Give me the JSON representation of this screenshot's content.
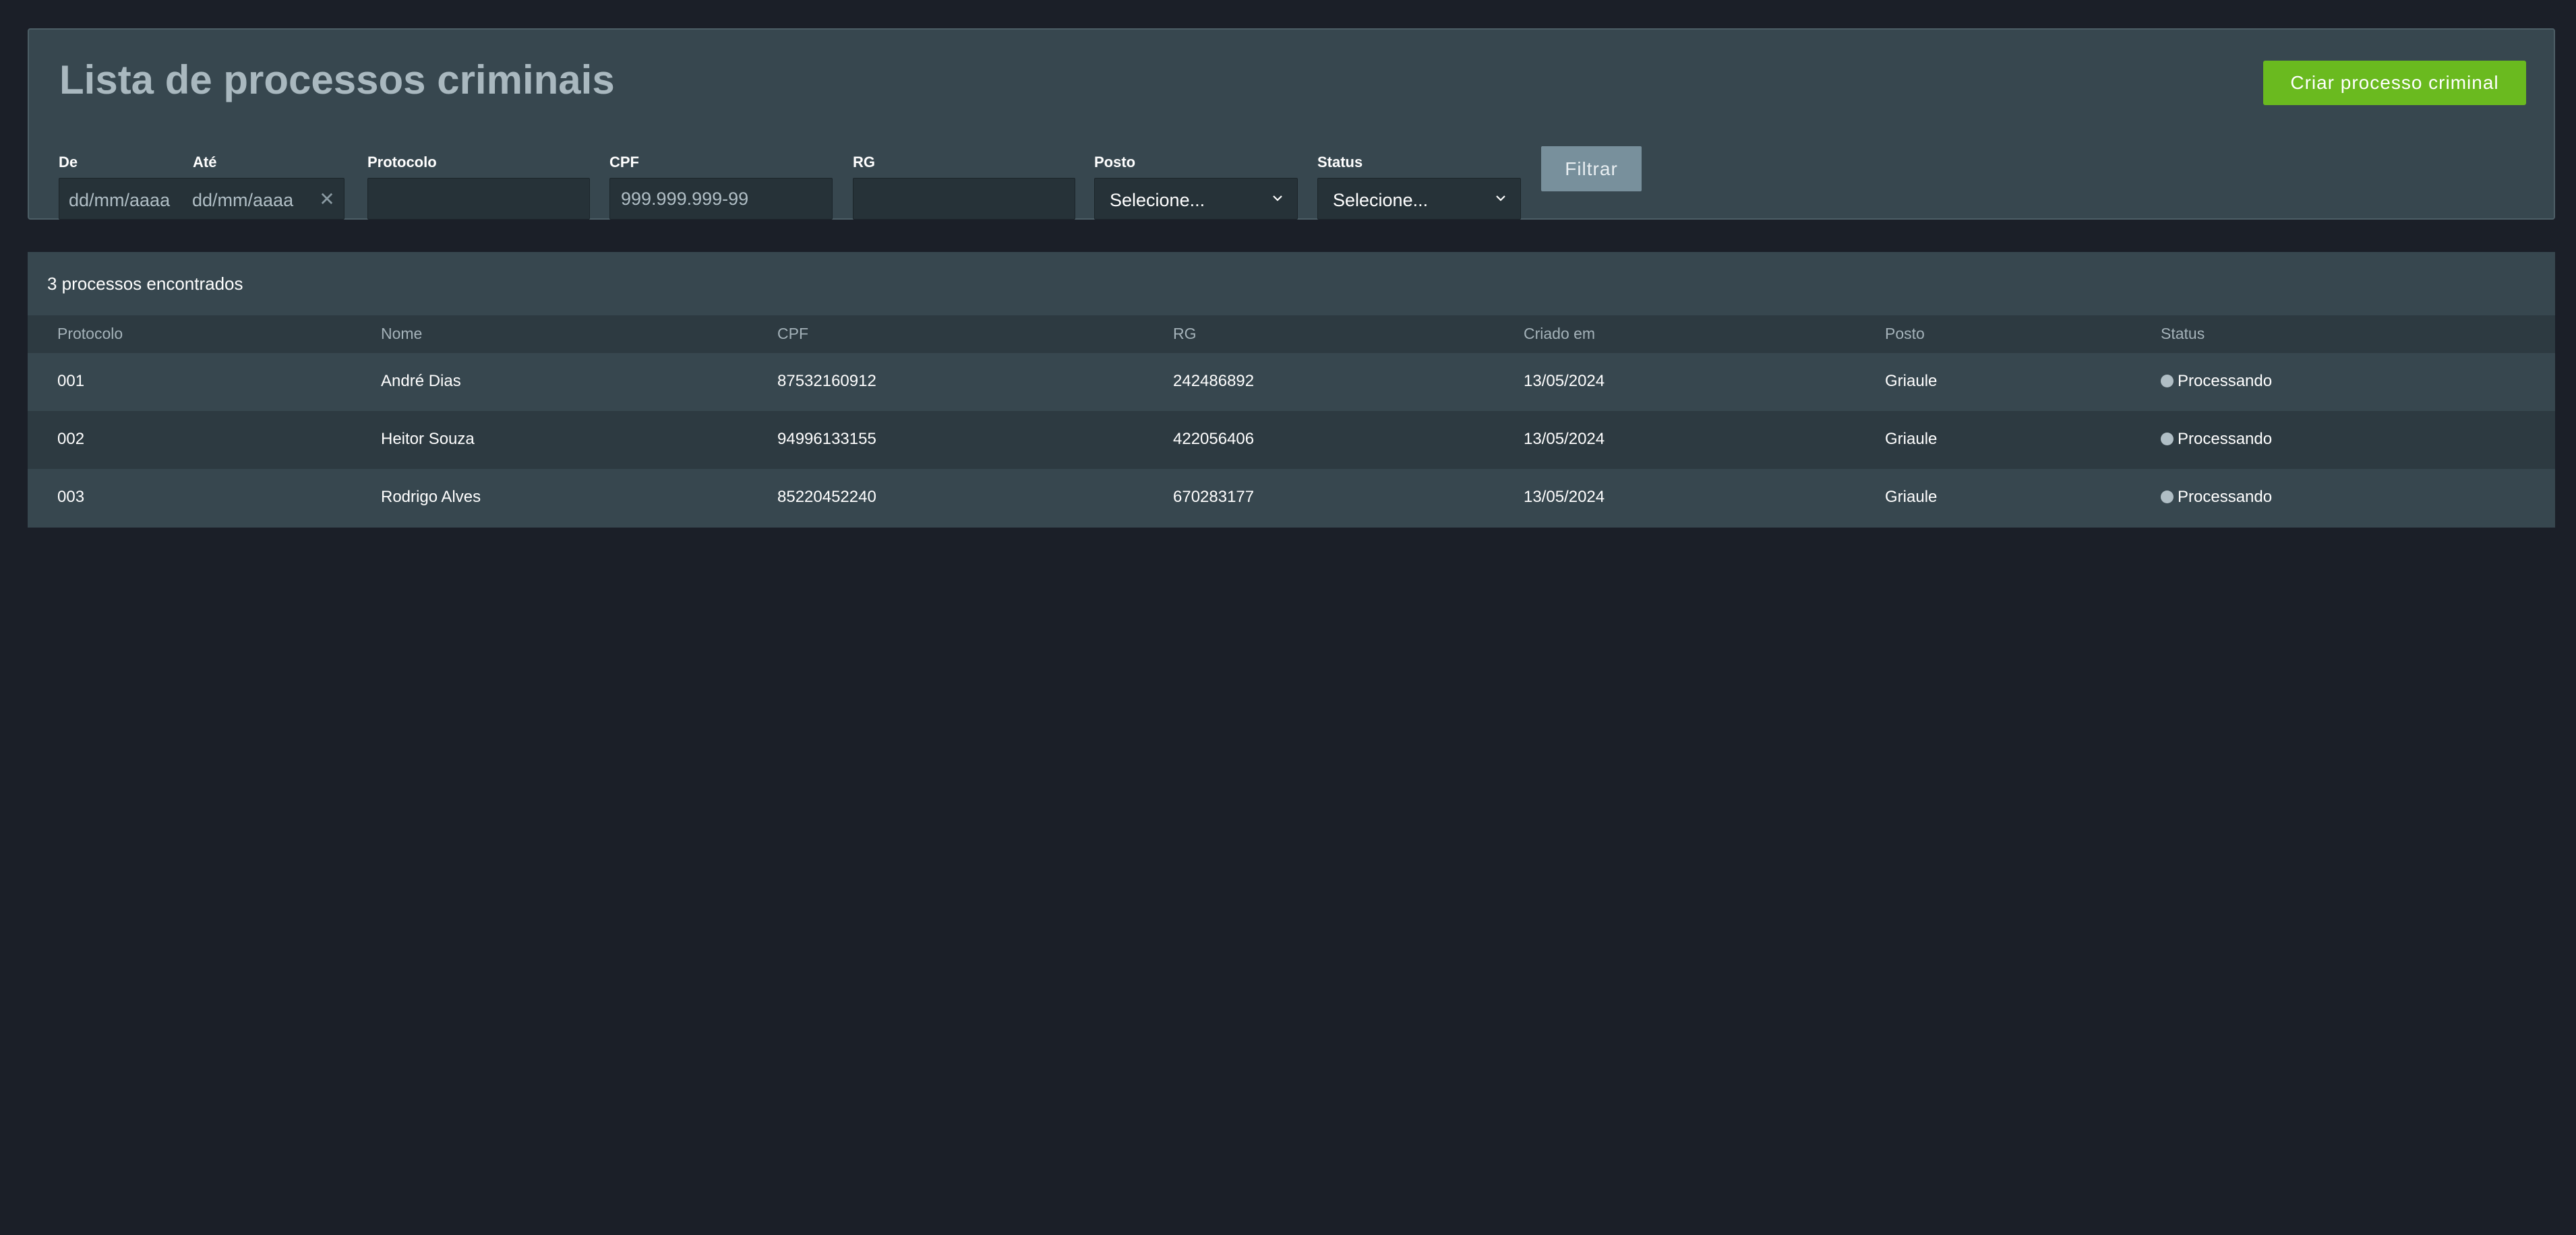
{
  "header": {
    "title": "Lista de processos criminais",
    "create_button_label": "Criar processo criminal"
  },
  "filters": {
    "de_label": "De",
    "ate_label": "Até",
    "de_placeholder": "dd/mm/aaaa",
    "ate_placeholder": "dd/mm/aaaa",
    "protocolo_label": "Protocolo",
    "protocolo_value": "",
    "cpf_label": "CPF",
    "cpf_placeholder": "999.999.999-99",
    "rg_label": "RG",
    "rg_value": "",
    "posto_label": "Posto",
    "posto_selected": "Selecione...",
    "status_label": "Status",
    "status_selected": "Selecione...",
    "filter_button_label": "Filtrar"
  },
  "results": {
    "count_text": "3 processos encontrados",
    "columns": [
      "Protocolo",
      "Nome",
      "CPF",
      "RG",
      "Criado em",
      "Posto",
      "Status"
    ],
    "rows": [
      {
        "protocolo": "001",
        "nome": "André Dias",
        "cpf": "87532160912",
        "rg": "242486892",
        "criado_em": "13/05/2024",
        "posto": "Griaule",
        "status": "Processando"
      },
      {
        "protocolo": "002",
        "nome": "Heitor Souza",
        "cpf": "94996133155",
        "rg": "422056406",
        "criado_em": "13/05/2024",
        "posto": "Griaule",
        "status": "Processando"
      },
      {
        "protocolo": "003",
        "nome": "Rodrigo Alves",
        "cpf": "85220452240",
        "rg": "670283177",
        "criado_em": "13/05/2024",
        "posto": "Griaule",
        "status": "Processando"
      }
    ]
  },
  "colors": {
    "primary_button": "#6aba1f",
    "filter_button": "#78909c",
    "panel_background": "#37474f",
    "page_background": "#1b1f28",
    "status_dot": "#b0bec5"
  }
}
